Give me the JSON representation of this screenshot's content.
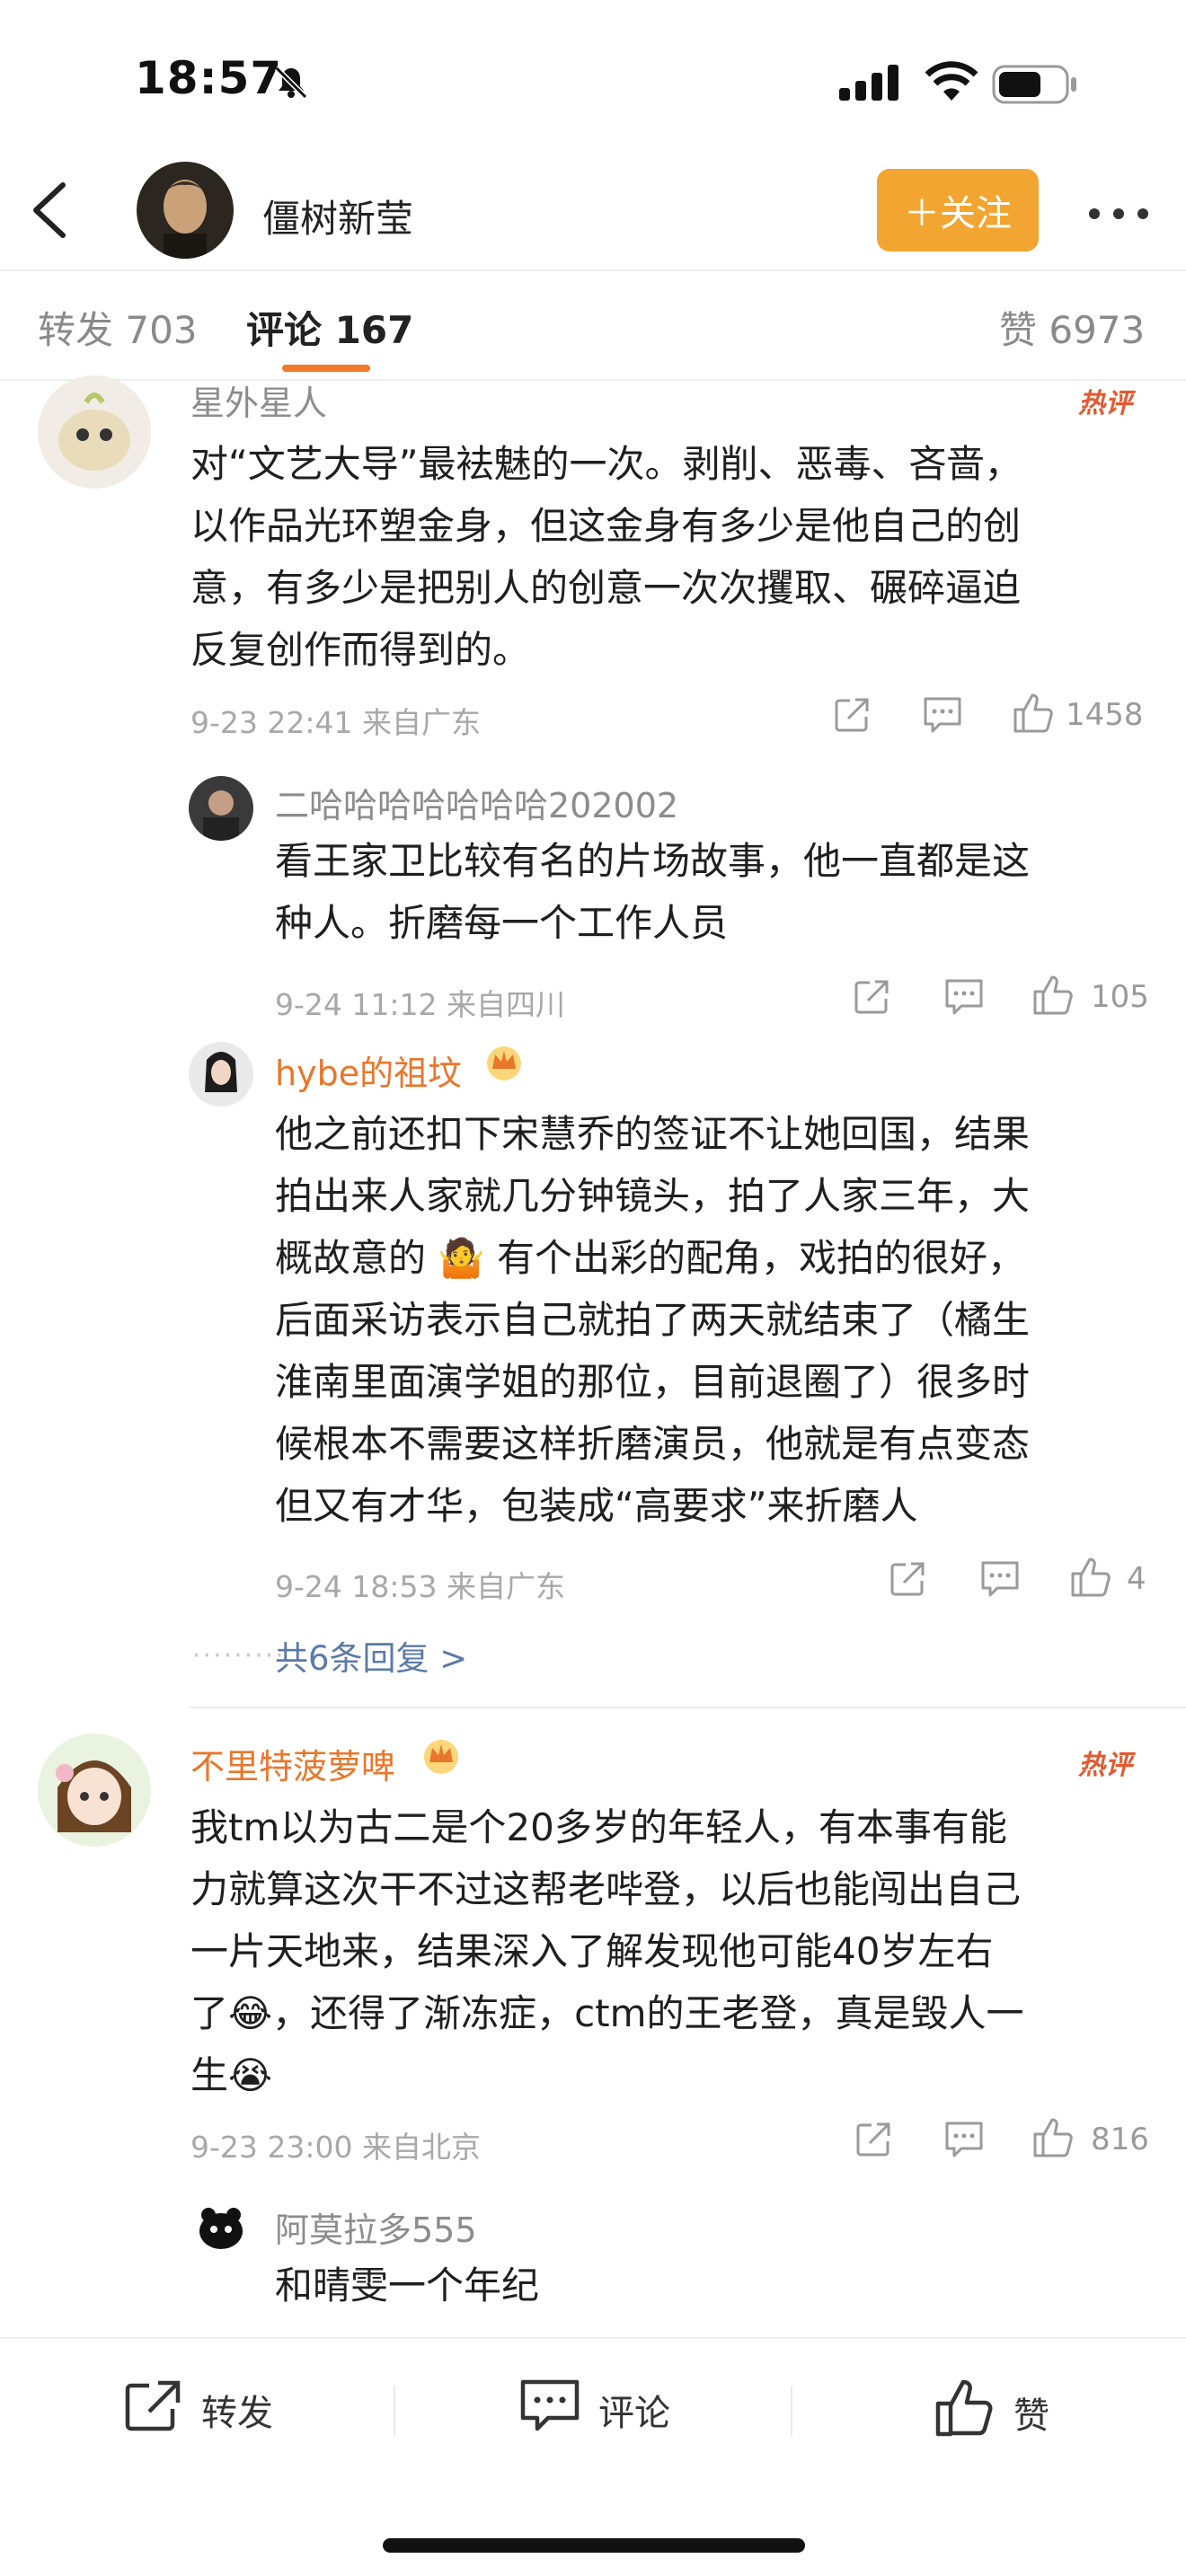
{
  "status": {
    "time": "18:57"
  },
  "header": {
    "name": "僵树新莹",
    "follow_label": "＋关注"
  },
  "tabs": {
    "repost": "转发 703",
    "comments": "评论 167",
    "likes": "赞 6973"
  },
  "comments": [
    {
      "user": "星外星人",
      "badge": "热评",
      "lines": [
        "对“文艺大导”最袪魅的一次。剥削、恶毒、吝啬，",
        "以作品光环塑金身，但这金身有多少是他自己的创",
        "意，有多少是把别人的创意一次次攫取、碾碎逼迫",
        "反复创作而得到的。"
      ],
      "meta": "9-23 22:41  来自广东",
      "likes": "1458",
      "replies": [
        {
          "user": "二哈哈哈哈哈哈哈202002",
          "lines": [
            "看王家卫比较有名的片场故事，他一直都是这",
            "种人。折磨每一个工作人员"
          ],
          "meta": "9-24 11:12  来自四川",
          "likes": "105"
        },
        {
          "user": "hybe的祖坟",
          "lines": [
            "他之前还扣下宋慧乔的签证不让她回国，结果",
            "拍出来人家就几分钟镜头，拍了人家三年，大",
            "概故意的 🤷 有个出彩的配角，戏拍的很好，",
            "后面采访表示自己就拍了两天就结束了（橘生",
            "淮南里面演学姐的那位，目前退圈了）很多时",
            "候根本不需要这样折磨演员，他就是有点变态",
            "但又有才华，包装成“高要求”来折磨人"
          ],
          "meta": "9-24 18:53  来自广东",
          "likes": "4"
        }
      ],
      "more_replies": "共6条回复 >"
    },
    {
      "user": "不里特菠萝啤",
      "badge": "热评",
      "lines": [
        "我tm以为古二是个20多岁的年轻人，有本事有能",
        "力就算这次干不过这帮老哔登，以后也能闯出自己",
        "一片天地来，结果深入了解发现他可能40岁左右",
        "了😂，还得了渐冻症，ctm的王老登，真是毁人一",
        "生😭"
      ],
      "meta": "9-23 23:00  来自北京",
      "likes": "816",
      "replies": [
        {
          "user": "阿莫拉多555",
          "lines": [
            "和晴雯一个年纪"
          ]
        }
      ]
    }
  ],
  "bottom": {
    "repost": "转发",
    "comment": "评论",
    "like": "赞"
  },
  "colors": {
    "accent": "#f3a531",
    "hot": "#e25a30",
    "link": "#5b7aa8",
    "vip_name": "#e8772b"
  }
}
